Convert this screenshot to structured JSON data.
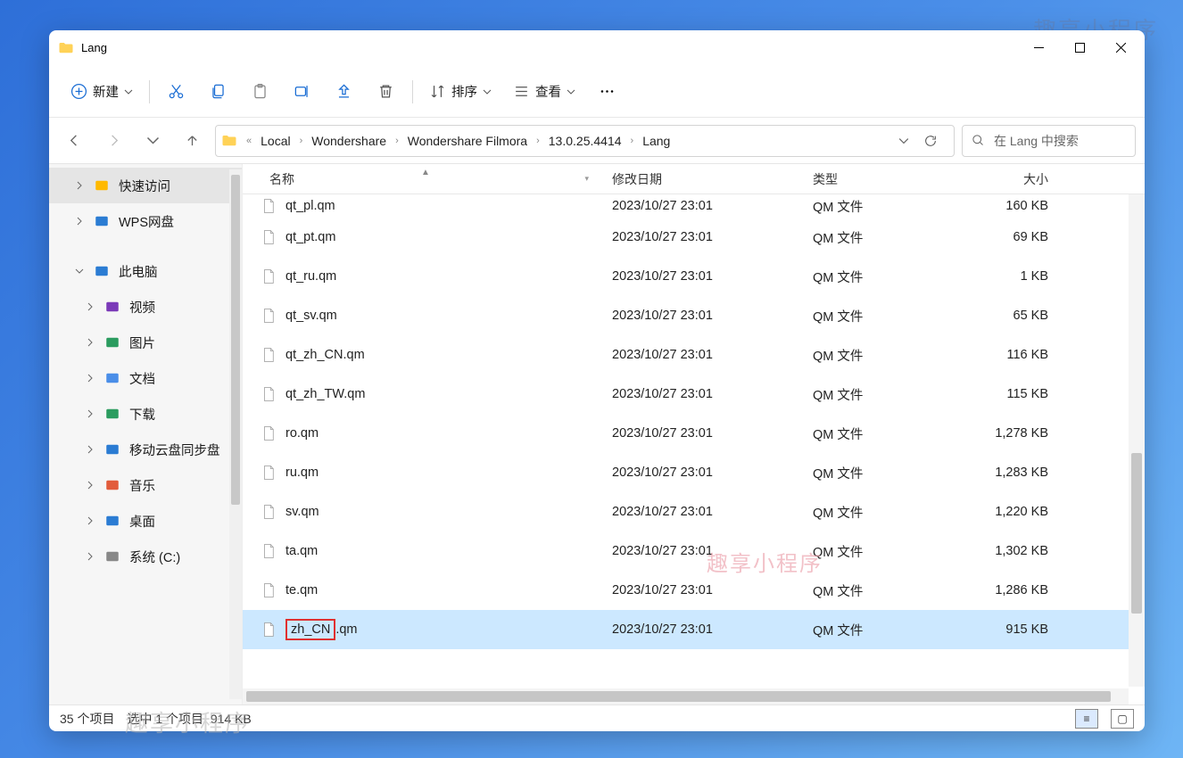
{
  "window": {
    "title": "Lang"
  },
  "toolbar": {
    "new": "新建",
    "sort": "排序",
    "view": "查看"
  },
  "breadcrumb": {
    "items": [
      "Local",
      "Wondershare",
      "Wondershare Filmora",
      "13.0.25.4414",
      "Lang"
    ]
  },
  "search": {
    "placeholder": "在 Lang 中搜索"
  },
  "sidebar": {
    "items": [
      {
        "label": "快速访问",
        "icon": "star",
        "expand": "right",
        "selected": true
      },
      {
        "label": "WPS网盘",
        "icon": "cloud",
        "expand": "right"
      },
      {
        "label": "此电脑",
        "icon": "pc",
        "expand": "down"
      },
      {
        "label": "视频",
        "icon": "video",
        "expand": "right",
        "indent": true
      },
      {
        "label": "图片",
        "icon": "image",
        "expand": "right",
        "indent": true
      },
      {
        "label": "文档",
        "icon": "doc",
        "expand": "right",
        "indent": true
      },
      {
        "label": "下载",
        "icon": "download",
        "expand": "right",
        "indent": true
      },
      {
        "label": "移动云盘同步盘",
        "icon": "sync",
        "expand": "right",
        "indent": true
      },
      {
        "label": "音乐",
        "icon": "music",
        "expand": "right",
        "indent": true
      },
      {
        "label": "桌面",
        "icon": "desktop",
        "expand": "right",
        "indent": true
      },
      {
        "label": "系统 (C:)",
        "icon": "disk",
        "expand": "right",
        "indent": true
      }
    ]
  },
  "columns": {
    "name": "名称",
    "date": "修改日期",
    "type": "类型",
    "size": "大小"
  },
  "files": [
    {
      "name": "qt_pl.qm",
      "date": "2023/10/27 23:01",
      "type": "QM 文件",
      "size": "160 KB",
      "clipped": true
    },
    {
      "name": "qt_pt.qm",
      "date": "2023/10/27 23:01",
      "type": "QM 文件",
      "size": "69 KB"
    },
    {
      "name": "qt_ru.qm",
      "date": "2023/10/27 23:01",
      "type": "QM 文件",
      "size": "1 KB"
    },
    {
      "name": "qt_sv.qm",
      "date": "2023/10/27 23:01",
      "type": "QM 文件",
      "size": "65 KB"
    },
    {
      "name": "qt_zh_CN.qm",
      "date": "2023/10/27 23:01",
      "type": "QM 文件",
      "size": "116 KB"
    },
    {
      "name": "qt_zh_TW.qm",
      "date": "2023/10/27 23:01",
      "type": "QM 文件",
      "size": "115 KB"
    },
    {
      "name": "ro.qm",
      "date": "2023/10/27 23:01",
      "type": "QM 文件",
      "size": "1,278 KB"
    },
    {
      "name": "ru.qm",
      "date": "2023/10/27 23:01",
      "type": "QM 文件",
      "size": "1,283 KB"
    },
    {
      "name": "sv.qm",
      "date": "2023/10/27 23:01",
      "type": "QM 文件",
      "size": "1,220 KB"
    },
    {
      "name": "ta.qm",
      "date": "2023/10/27 23:01",
      "type": "QM 文件",
      "size": "1,302 KB"
    },
    {
      "name": "te.qm",
      "date": "2023/10/27 23:01",
      "type": "QM 文件",
      "size": "1,286 KB"
    },
    {
      "name": "zh_CN.qm",
      "date": "2023/10/27 23:01",
      "type": "QM 文件",
      "size": "915 KB",
      "selected": true,
      "rename": "zh_CN"
    }
  ],
  "status": {
    "count": "35 个项目",
    "selection": "选中 1 个项目",
    "selsize": "914 KB"
  },
  "watermark": "趣享小程序"
}
